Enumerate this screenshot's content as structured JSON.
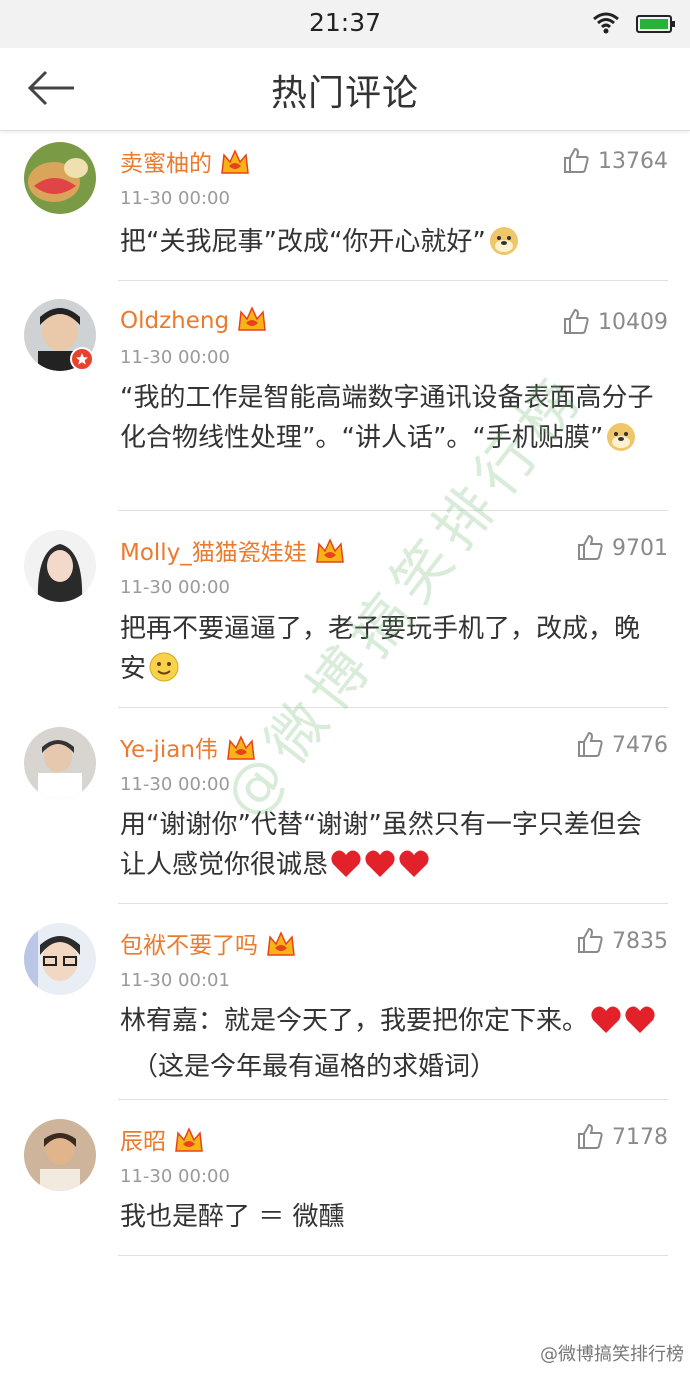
{
  "status": {
    "time": "21:37"
  },
  "header": {
    "title": "热门评论",
    "back_icon": "back-arrow-icon"
  },
  "comments": [
    {
      "user": "卖蜜柚的",
      "time": "11-30 00:00",
      "likes": "13764",
      "text": "把“关我屁事”改成“你开心就好”",
      "emoji": [
        "doge"
      ]
    },
    {
      "user": "Oldzheng",
      "time": "11-30 00:00",
      "likes": "10409",
      "text": "“我的工作是智能高端数字通讯设备表面高分子化合物线性处理”。“讲人话”。“手机贴膜”",
      "emoji": [
        "doge"
      ]
    },
    {
      "user": "Molly_猫猫瓷娃娃",
      "time": "11-30 00:00",
      "likes": "9701",
      "text": "把再不要逼逼了，老子要玩手机了，改成，晚安",
      "emoji": [
        "smile"
      ]
    },
    {
      "user": "Ye-jian伟",
      "time": "11-30 00:00",
      "likes": "7476",
      "text": "用“谢谢你”代替“谢谢”虽然只有一字只差但会让人感觉你很诚恳",
      "emoji": [
        "heart",
        "heart",
        "heart"
      ]
    },
    {
      "user": "包袱不要了吗",
      "time": "11-30 00:01",
      "likes": "7835",
      "text": "林宥嘉：就是今天了，我要把你定下来。",
      "text2": "（这是今年最有逼格的求婚词）",
      "emoji": [
        "heart",
        "heart"
      ]
    },
    {
      "user": "辰昭",
      "time": "11-30 00:00",
      "likes": "7178",
      "text": "我也是醉了 ＝ 微醺",
      "emoji": []
    }
  ],
  "watermark": "@微博搞笑排行榜",
  "footer_mark": "@微博搞笑排行榜",
  "colors": {
    "username": "#eb7a2c",
    "text": "#333333",
    "meta": "#9a9a9a"
  }
}
